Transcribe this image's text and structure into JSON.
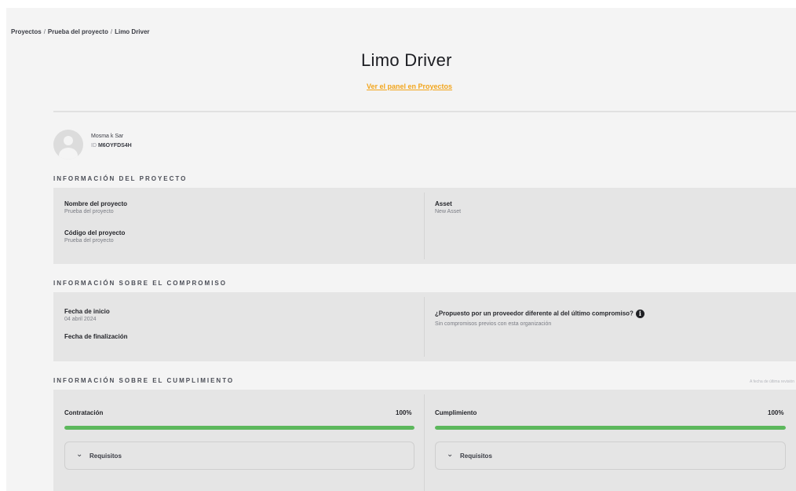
{
  "breadcrumb": [
    "Proyectos",
    "Prueba del proyecto",
    "Limo Driver"
  ],
  "breadcrumb_separator": "/",
  "page_title": "Limo Driver",
  "portal_link": "Ver el panel en Proyectos",
  "user": {
    "name": "Mosma k Sar",
    "id_prefix": "ID",
    "id_value": "M6OYFDS4H"
  },
  "project_info": {
    "heading": "INFORMACIÓN DEL PROYECTO",
    "project_name_label": "Nombre del proyecto",
    "project_name_value": "Prueba del proyecto",
    "project_code_label": "Código del proyecto",
    "project_code_value": "Prueba del proyecto",
    "asset_label": "Asset",
    "asset_value": "New Asset"
  },
  "engagement_info": {
    "heading": "INFORMACIÓN SOBRE EL COMPROMISO",
    "start_date_label": "Fecha de inicio",
    "start_date_value": "04 abril 2024",
    "end_date_label": "Fecha de finalización",
    "supplier_question": "¿Propuesto por un proveedor diferente al del último compromiso?",
    "supplier_answer": "Sin compromisos previos con esta organización"
  },
  "compliance_info": {
    "heading": "INFORMACIÓN SOBRE EL CUMPLIMIENTO",
    "note": "A fecha de última revisión",
    "contracting_label": "Contratación",
    "contracting_percent": "100%",
    "contracting_progress": 1.0,
    "compliance_label": "Cumplimiento",
    "compliance_percent": "100%",
    "compliance_progress": 1.0,
    "requirements_label": "Requisitos"
  },
  "colors": {
    "accent": "#f2a51b",
    "progress": "#5cb85c",
    "panel": "#e5e5e5"
  },
  "icons": {
    "info": "info-icon",
    "chevron": "chevron-down-icon",
    "avatar": "user-avatar-icon"
  }
}
